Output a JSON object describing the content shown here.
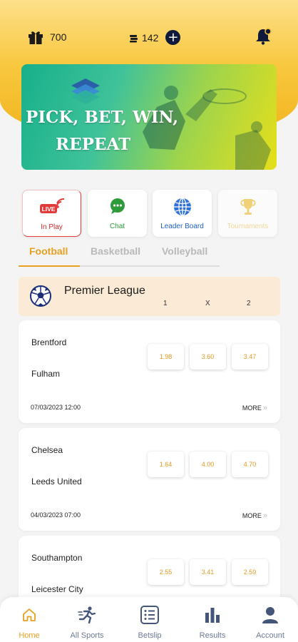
{
  "header": {
    "gift_count": "700",
    "coin_count": "142",
    "plus_label": "+"
  },
  "banner": {
    "line1": "PICK, BET, WIN,",
    "line2": "REPEAT"
  },
  "quick_actions": {
    "inplay": {
      "badge": "LIVE",
      "label": "In Play",
      "icon": "live-icon"
    },
    "chat": {
      "label": "Chat",
      "icon": "chat-icon"
    },
    "leaderboard": {
      "label": "Leader Board",
      "icon": "globe-icon"
    },
    "tournaments": {
      "label": "Tournaments",
      "icon": "trophy-icon"
    }
  },
  "sport_tabs": [
    {
      "label": "Football",
      "active": true
    },
    {
      "label": "Basketball",
      "active": false
    },
    {
      "label": "Volleyball",
      "active": false
    }
  ],
  "league": {
    "name": "Premier League",
    "col1": "1",
    "colx": "X",
    "col2": "2"
  },
  "matches": [
    {
      "home": "Brentford",
      "away": "Fulham",
      "odd1": "1.98",
      "oddx": "3.60",
      "odd2": "3.47",
      "kickoff": "07/03/2023  12:00",
      "more": "MORE"
    },
    {
      "home": "Chelsea",
      "away": "Leeds United",
      "odd1": "1.64",
      "oddx": "4.00",
      "odd2": "4.70",
      "kickoff": "04/03/2023  07:00",
      "more": "MORE"
    },
    {
      "home": "Southampton",
      "away": "Leicester City",
      "odd1": "2.55",
      "oddx": "3.41",
      "odd2": "2.59",
      "kickoff": "",
      "more": ""
    }
  ],
  "bottom_nav": [
    {
      "label": "Home",
      "icon": "home-icon",
      "active": true
    },
    {
      "label": "All Sports",
      "icon": "runner-icon",
      "active": false
    },
    {
      "label": "Betslip",
      "icon": "betslip-icon",
      "active": false
    },
    {
      "label": "Results",
      "icon": "bar-chart-icon",
      "active": false
    },
    {
      "label": "Account",
      "icon": "user-icon",
      "active": false
    }
  ],
  "colors": {
    "accent": "#e8a020",
    "header_top": "#fde08a",
    "header_bottom": "#f2b21a",
    "live_red": "#e23a3a",
    "chat_green": "#2e9b3a",
    "leader_blue": "#1f5fc7",
    "league_bg": "#fbebd6"
  }
}
